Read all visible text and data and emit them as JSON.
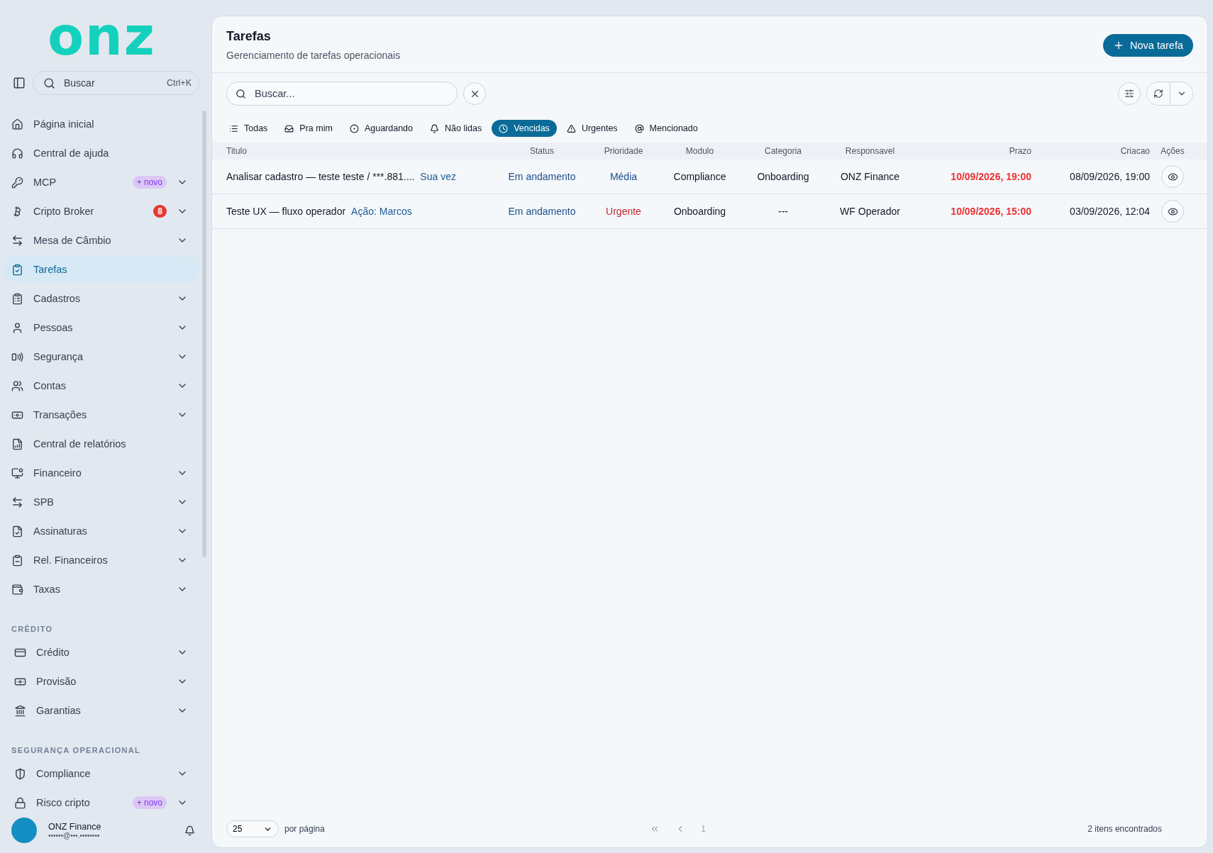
{
  "sidebar": {
    "logo": "onz",
    "search": {
      "placeholder": "Buscar",
      "shortcut": "Ctrl+K"
    },
    "sections": [
      {
        "items": [
          {
            "label": "Página inicial",
            "expandable": false,
            "selected": false
          },
          {
            "label": "Central de ajuda",
            "expandable": false,
            "selected": false
          },
          {
            "label": "MCP",
            "expandable": true,
            "selected": false,
            "badge": {
              "kind": "new",
              "text": "+ novo"
            }
          },
          {
            "label": "Cripto Broker",
            "expandable": true,
            "selected": false,
            "badge": {
              "kind": "count",
              "text": "8"
            }
          },
          {
            "label": "Mesa de Câmbio",
            "expandable": true,
            "selected": false
          },
          {
            "label": "Tarefas",
            "expandable": false,
            "selected": true
          },
          {
            "label": "Cadastros",
            "expandable": true,
            "selected": false
          },
          {
            "label": "Pessoas",
            "expandable": true,
            "selected": false
          },
          {
            "label": "Segurança",
            "expandable": true,
            "selected": false
          },
          {
            "label": "Contas",
            "expandable": true,
            "selected": false
          },
          {
            "label": "Transações",
            "expandable": true,
            "selected": false
          },
          {
            "label": "Central de relatórios",
            "expandable": false,
            "selected": false
          },
          {
            "label": "Financeiro",
            "expandable": true,
            "selected": false
          },
          {
            "label": "SPB",
            "expandable": true,
            "selected": false
          },
          {
            "label": "Assinaturas",
            "expandable": true,
            "selected": false
          },
          {
            "label": "Rel. Financeiros",
            "expandable": true,
            "selected": false
          },
          {
            "label": "Taxas",
            "expandable": true,
            "selected": false
          }
        ]
      },
      {
        "heading": "CRÉDITO",
        "items": [
          {
            "label": "Crédito",
            "expandable": true,
            "selected": false
          },
          {
            "label": "Provisão",
            "expandable": true,
            "selected": false
          },
          {
            "label": "Garantias",
            "expandable": true,
            "selected": false
          }
        ]
      },
      {
        "heading": "SEGURANÇA OPERACIONAL",
        "items": [
          {
            "label": "Compliance",
            "expandable": true,
            "selected": false
          },
          {
            "label": "Risco cripto",
            "expandable": true,
            "selected": false,
            "badge": {
              "kind": "new",
              "text": "+ novo"
            }
          }
        ]
      }
    ],
    "user": {
      "name": "ONZ Finance",
      "email": "••••••@•••.••••••••"
    }
  },
  "header": {
    "title": "Tarefas",
    "subtitle": "Gerenciamento de tarefas operacionais",
    "new_button": "Nova tarefa"
  },
  "search": {
    "placeholder": "Buscar..."
  },
  "filters": [
    {
      "label": "Todas",
      "selected": false
    },
    {
      "label": "Pra mim",
      "selected": false
    },
    {
      "label": "Aguardando",
      "selected": false
    },
    {
      "label": "Não lidas",
      "selected": false
    },
    {
      "label": "Vencidas",
      "selected": true
    },
    {
      "label": "Urgentes",
      "selected": false
    },
    {
      "label": "Mencionado",
      "selected": false
    }
  ],
  "table": {
    "columns": [
      "Titulo",
      "Status",
      "Prioridade",
      "Modulo",
      "Categoria",
      "Responsavel",
      "Prazo",
      "Criacao",
      "Ações"
    ],
    "rows": [
      {
        "title": "Analisar cadastro — teste teste / ***.881....",
        "tag": "Sua vez",
        "status": "Em andamento",
        "priority": {
          "label": "Média",
          "color": "#1e4f8a"
        },
        "module": "Compliance",
        "category": "Onboarding",
        "owner": "ONZ Finance",
        "due": "10/09/2026, 19:00",
        "overdue": true,
        "created": "08/09/2026, 19:00"
      },
      {
        "title": "Teste UX — fluxo operador",
        "tag": "Ação: Marcos",
        "status": "Em andamento",
        "priority": {
          "label": "Urgente",
          "color": "#c0272d"
        },
        "module": "Onboarding",
        "category": "---",
        "owner": "WF Operador",
        "due": "10/09/2026, 15:00",
        "overdue": true,
        "created": "03/09/2026, 12:04"
      }
    ]
  },
  "footer": {
    "page_size": "25",
    "page_size_label": "por página",
    "page": "1",
    "count": "2 itens encontrados"
  }
}
